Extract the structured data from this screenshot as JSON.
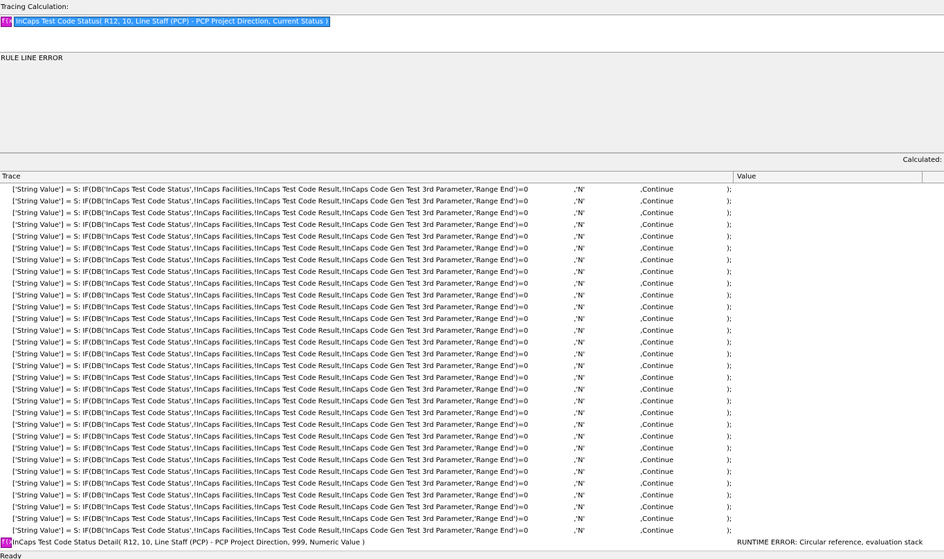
{
  "tracing_label": "Tracing Calculation:",
  "calc": {
    "icon": "fx-icon",
    "text": "InCaps Test Code Status( R12, 10, Line Staff (PCP) - PCP Project Direction, Current Status )"
  },
  "error_pane": {
    "text": "RULE LINE ERROR"
  },
  "calculated_label": "Calculated:",
  "columns": {
    "trace": "Trace",
    "value": "Value"
  },
  "trace_rows": [
    {
      "expr": "['String Value'] = S: IF(DB('InCaps Test Code Status',!InCaps Facilities,!InCaps Test Code Result,!InCaps Code Gen Test 3rd Parameter,'Range End')=0",
      "arg": ",'N'",
      "action": ",Continue",
      "end": ");"
    },
    {
      "expr": "['String Value'] = S: IF(DB('InCaps Test Code Status',!InCaps Facilities,!InCaps Test Code Result,!InCaps Code Gen Test 3rd Parameter,'Range End')=0",
      "arg": ",'N'",
      "action": ",Continue",
      "end": ");"
    },
    {
      "expr": "['String Value'] = S: IF(DB('InCaps Test Code Status',!InCaps Facilities,!InCaps Test Code Result,!InCaps Code Gen Test 3rd Parameter,'Range End')=0",
      "arg": ",'N'",
      "action": ",Continue",
      "end": ");"
    },
    {
      "expr": "['String Value'] = S: IF(DB('InCaps Test Code Status',!InCaps Facilities,!InCaps Test Code Result,!InCaps Code Gen Test 3rd Parameter,'Range End')=0",
      "arg": ",'N'",
      "action": ",Continue",
      "end": ");"
    },
    {
      "expr": "['String Value'] = S: IF(DB('InCaps Test Code Status',!InCaps Facilities,!InCaps Test Code Result,!InCaps Code Gen Test 3rd Parameter,'Range End')=0",
      "arg": ",'N'",
      "action": ",Continue",
      "end": ");"
    },
    {
      "expr": "['String Value'] = S: IF(DB('InCaps Test Code Status',!InCaps Facilities,!InCaps Test Code Result,!InCaps Code Gen Test 3rd Parameter,'Range End')=0",
      "arg": ",'N'",
      "action": ",Continue",
      "end": ");"
    },
    {
      "expr": "['String Value'] = S: IF(DB('InCaps Test Code Status',!InCaps Facilities,!InCaps Test Code Result,!InCaps Code Gen Test 3rd Parameter,'Range End')=0",
      "arg": ",'N'",
      "action": ",Continue",
      "end": ");"
    },
    {
      "expr": "['String Value'] = S: IF(DB('InCaps Test Code Status',!InCaps Facilities,!InCaps Test Code Result,!InCaps Code Gen Test 3rd Parameter,'Range End')=0",
      "arg": ",'N'",
      "action": ",Continue",
      "end": ");"
    },
    {
      "expr": "['String Value'] = S: IF(DB('InCaps Test Code Status',!InCaps Facilities,!InCaps Test Code Result,!InCaps Code Gen Test 3rd Parameter,'Range End')=0",
      "arg": ",'N'",
      "action": ",Continue",
      "end": ");"
    },
    {
      "expr": "['String Value'] = S: IF(DB('InCaps Test Code Status',!InCaps Facilities,!InCaps Test Code Result,!InCaps Code Gen Test 3rd Parameter,'Range End')=0",
      "arg": ",'N'",
      "action": ",Continue",
      "end": ");"
    },
    {
      "expr": "['String Value'] = S: IF(DB('InCaps Test Code Status',!InCaps Facilities,!InCaps Test Code Result,!InCaps Code Gen Test 3rd Parameter,'Range End')=0",
      "arg": ",'N'",
      "action": ",Continue",
      "end": ");"
    },
    {
      "expr": "['String Value'] = S: IF(DB('InCaps Test Code Status',!InCaps Facilities,!InCaps Test Code Result,!InCaps Code Gen Test 3rd Parameter,'Range End')=0",
      "arg": ",'N'",
      "action": ",Continue",
      "end": ");"
    },
    {
      "expr": "['String Value'] = S: IF(DB('InCaps Test Code Status',!InCaps Facilities,!InCaps Test Code Result,!InCaps Code Gen Test 3rd Parameter,'Range End')=0",
      "arg": ",'N'",
      "action": ",Continue",
      "end": ");"
    },
    {
      "expr": "['String Value'] = S: IF(DB('InCaps Test Code Status',!InCaps Facilities,!InCaps Test Code Result,!InCaps Code Gen Test 3rd Parameter,'Range End')=0",
      "arg": ",'N'",
      "action": ",Continue",
      "end": ");"
    },
    {
      "expr": "['String Value'] = S: IF(DB('InCaps Test Code Status',!InCaps Facilities,!InCaps Test Code Result,!InCaps Code Gen Test 3rd Parameter,'Range End')=0",
      "arg": ",'N'",
      "action": ",Continue",
      "end": ");"
    },
    {
      "expr": "['String Value'] = S: IF(DB('InCaps Test Code Status',!InCaps Facilities,!InCaps Test Code Result,!InCaps Code Gen Test 3rd Parameter,'Range End')=0",
      "arg": ",'N'",
      "action": ",Continue",
      "end": ");"
    },
    {
      "expr": "['String Value'] = S: IF(DB('InCaps Test Code Status',!InCaps Facilities,!InCaps Test Code Result,!InCaps Code Gen Test 3rd Parameter,'Range End')=0",
      "arg": ",'N'",
      "action": ",Continue",
      "end": ");"
    },
    {
      "expr": "['String Value'] = S: IF(DB('InCaps Test Code Status',!InCaps Facilities,!InCaps Test Code Result,!InCaps Code Gen Test 3rd Parameter,'Range End')=0",
      "arg": ",'N'",
      "action": ",Continue",
      "end": ");"
    },
    {
      "expr": "['String Value'] = S: IF(DB('InCaps Test Code Status',!InCaps Facilities,!InCaps Test Code Result,!InCaps Code Gen Test 3rd Parameter,'Range End')=0",
      "arg": ",'N'",
      "action": ",Continue",
      "end": ");"
    },
    {
      "expr": "['String Value'] = S: IF(DB('InCaps Test Code Status',!InCaps Facilities,!InCaps Test Code Result,!InCaps Code Gen Test 3rd Parameter,'Range End')=0",
      "arg": ",'N'",
      "action": ",Continue",
      "end": ");"
    },
    {
      "expr": "['String Value'] = S: IF(DB('InCaps Test Code Status',!InCaps Facilities,!InCaps Test Code Result,!InCaps Code Gen Test 3rd Parameter,'Range End')=0",
      "arg": ",'N'",
      "action": ",Continue",
      "end": ");"
    },
    {
      "expr": "['String Value'] = S: IF(DB('InCaps Test Code Status',!InCaps Facilities,!InCaps Test Code Result,!InCaps Code Gen Test 3rd Parameter,'Range End')=0",
      "arg": ",'N'",
      "action": ",Continue",
      "end": ");"
    },
    {
      "expr": "['String Value'] = S: IF(DB('InCaps Test Code Status',!InCaps Facilities,!InCaps Test Code Result,!InCaps Code Gen Test 3rd Parameter,'Range End')=0",
      "arg": ",'N'",
      "action": ",Continue",
      "end": ");"
    },
    {
      "expr": "['String Value'] = S: IF(DB('InCaps Test Code Status',!InCaps Facilities,!InCaps Test Code Result,!InCaps Code Gen Test 3rd Parameter,'Range End')=0",
      "arg": ",'N'",
      "action": ",Continue",
      "end": ");"
    },
    {
      "expr": "['String Value'] = S: IF(DB('InCaps Test Code Status',!InCaps Facilities,!InCaps Test Code Result,!InCaps Code Gen Test 3rd Parameter,'Range End')=0",
      "arg": ",'N'",
      "action": ",Continue",
      "end": ");"
    },
    {
      "expr": "['String Value'] = S: IF(DB('InCaps Test Code Status',!InCaps Facilities,!InCaps Test Code Result,!InCaps Code Gen Test 3rd Parameter,'Range End')=0",
      "arg": ",'N'",
      "action": ",Continue",
      "end": ");"
    },
    {
      "expr": "['String Value'] = S: IF(DB('InCaps Test Code Status',!InCaps Facilities,!InCaps Test Code Result,!InCaps Code Gen Test 3rd Parameter,'Range End')=0",
      "arg": ",'N'",
      "action": ",Continue",
      "end": ");"
    },
    {
      "expr": "['String Value'] = S: IF(DB('InCaps Test Code Status',!InCaps Facilities,!InCaps Test Code Result,!InCaps Code Gen Test 3rd Parameter,'Range End')=0",
      "arg": ",'N'",
      "action": ",Continue",
      "end": ");"
    },
    {
      "expr": "['String Value'] = S: IF(DB('InCaps Test Code Status',!InCaps Facilities,!InCaps Test Code Result,!InCaps Code Gen Test 3rd Parameter,'Range End')=0",
      "arg": ",'N'",
      "action": ",Continue",
      "end": ");"
    },
    {
      "expr": "['String Value'] = S: IF(DB('InCaps Test Code Status',!InCaps Facilities,!InCaps Test Code Result,!InCaps Code Gen Test 3rd Parameter,'Range End')=0",
      "arg": ",'N'",
      "action": ",Continue",
      "end": ");"
    }
  ],
  "bottom_row": {
    "icon": "fx-icon",
    "trace": "InCaps Test Code Status Detail( R12, 10, Line Staff (PCP) - PCP Project Direction, 999, Numeric Value )",
    "value": "RUNTIME ERROR: Circular reference, evaluation stack"
  },
  "status": "Ready",
  "colors": {
    "fx_icon": "#d21fd2",
    "selection": "#3399ff",
    "panel_bg": "#f0f0f0"
  }
}
